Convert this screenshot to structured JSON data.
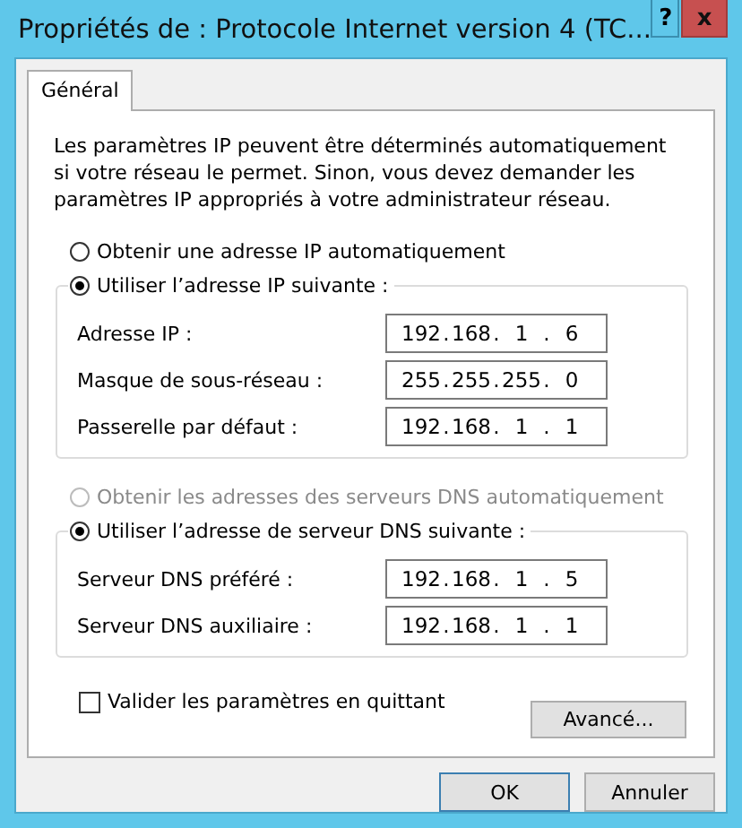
{
  "window": {
    "title": "Propriétés de : Protocole Internet version 4 (TC...",
    "help_button": "?",
    "close_button": "x"
  },
  "tabs": [
    {
      "label": "Général",
      "selected": true
    }
  ],
  "description": "Les paramètres IP peuvent être déterminés automatiquement si votre réseau le permet. Sinon, vous devez demander les paramètres IP appropriés à votre administrateur réseau.",
  "ip_separator": ".",
  "sections": [
    {
      "auto_option": {
        "label": "Obtenir une adresse IP automatiquement",
        "selected": false,
        "disabled": false
      },
      "manual_option": {
        "label": "Utiliser l’adresse IP suivante :",
        "selected": true,
        "disabled": false
      },
      "fields": [
        {
          "label": "Adresse IP :",
          "octets": [
            "192",
            "168",
            "1",
            "6"
          ]
        },
        {
          "label": "Masque de sous-réseau :",
          "octets": [
            "255",
            "255",
            "255",
            "0"
          ]
        },
        {
          "label": "Passerelle par défaut :",
          "octets": [
            "192",
            "168",
            "1",
            "1"
          ]
        }
      ]
    },
    {
      "auto_option": {
        "label": "Obtenir les adresses des serveurs DNS automatiquement",
        "selected": false,
        "disabled": true
      },
      "manual_option": {
        "label": "Utiliser l’adresse de serveur DNS suivante :",
        "selected": true,
        "disabled": false
      },
      "fields": [
        {
          "label": "Serveur DNS préféré :",
          "octets": [
            "192",
            "168",
            "1",
            "5"
          ]
        },
        {
          "label": "Serveur DNS auxiliaire :",
          "octets": [
            "192",
            "168",
            "1",
            "1"
          ]
        }
      ]
    }
  ],
  "validate_checkbox": {
    "label": "Valider les paramètres en quittant",
    "checked": false
  },
  "advanced_button": "Avancé...",
  "buttons": [
    "OK",
    "Annuler"
  ]
}
